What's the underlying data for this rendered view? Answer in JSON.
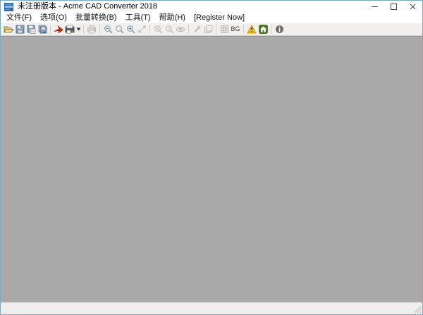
{
  "window": {
    "title": "未注册版本 - Acme CAD Converter 2018",
    "app_icon": "acme-cad-converter-app-icon",
    "controls": [
      "minimize",
      "maximize",
      "close"
    ]
  },
  "menu": {
    "items": [
      {
        "label": "文件(F)"
      },
      {
        "label": "选项(O)"
      },
      {
        "label": "批量转换(B)"
      },
      {
        "label": "工具(T)"
      },
      {
        "label": "帮助(H)"
      },
      {
        "label": "[Register Now]"
      }
    ]
  },
  "toolbar": {
    "bg_label": "BG",
    "buttons": [
      {
        "icon": "open-file-icon",
        "enabled": true
      },
      {
        "icon": "save-icon",
        "enabled": true
      },
      {
        "icon": "save-as-icon",
        "enabled": true
      },
      {
        "icon": "save-all-icon",
        "enabled": true
      },
      {
        "icon": "convert-icon",
        "enabled": true
      },
      {
        "icon": "batch-convert-icon",
        "enabled": true
      },
      {
        "icon": "convert-dropdown-arrow-icon",
        "enabled": true
      },
      {
        "icon": "print-icon",
        "enabled": false
      },
      {
        "icon": "zoom-out-icon",
        "enabled": true
      },
      {
        "icon": "zoom-realtime-icon",
        "enabled": true
      },
      {
        "icon": "zoom-in-icon",
        "enabled": true
      },
      {
        "icon": "zoom-extents-icon",
        "enabled": false
      },
      {
        "icon": "zoom-window-icon",
        "enabled": false
      },
      {
        "icon": "zoom-previous-icon",
        "enabled": false
      },
      {
        "icon": "view-eye-icon",
        "enabled": false
      },
      {
        "icon": "redraw-icon",
        "enabled": false
      },
      {
        "icon": "layers-icon",
        "enabled": false
      },
      {
        "icon": "grid-icon",
        "enabled": false
      },
      {
        "icon": "bg-toggle-button",
        "enabled": true
      },
      {
        "icon": "purchase-warning-icon",
        "enabled": true
      },
      {
        "icon": "home-icon",
        "enabled": true
      },
      {
        "icon": "about-info-icon",
        "enabled": true
      }
    ]
  },
  "statusbar": {
    "text": ""
  },
  "colors": {
    "window_border": "#7aaac4",
    "titlebar_bg": "#ffffff",
    "menubar_bg": "#ffffff",
    "toolbar_bg": "#f1f0ef",
    "client_bg": "#a9a9a9",
    "statusbar_bg": "#f0efee",
    "convert_red": "#cc2100",
    "warning_yellow": "#f2c200",
    "home_green": "#4d7d1f"
  }
}
